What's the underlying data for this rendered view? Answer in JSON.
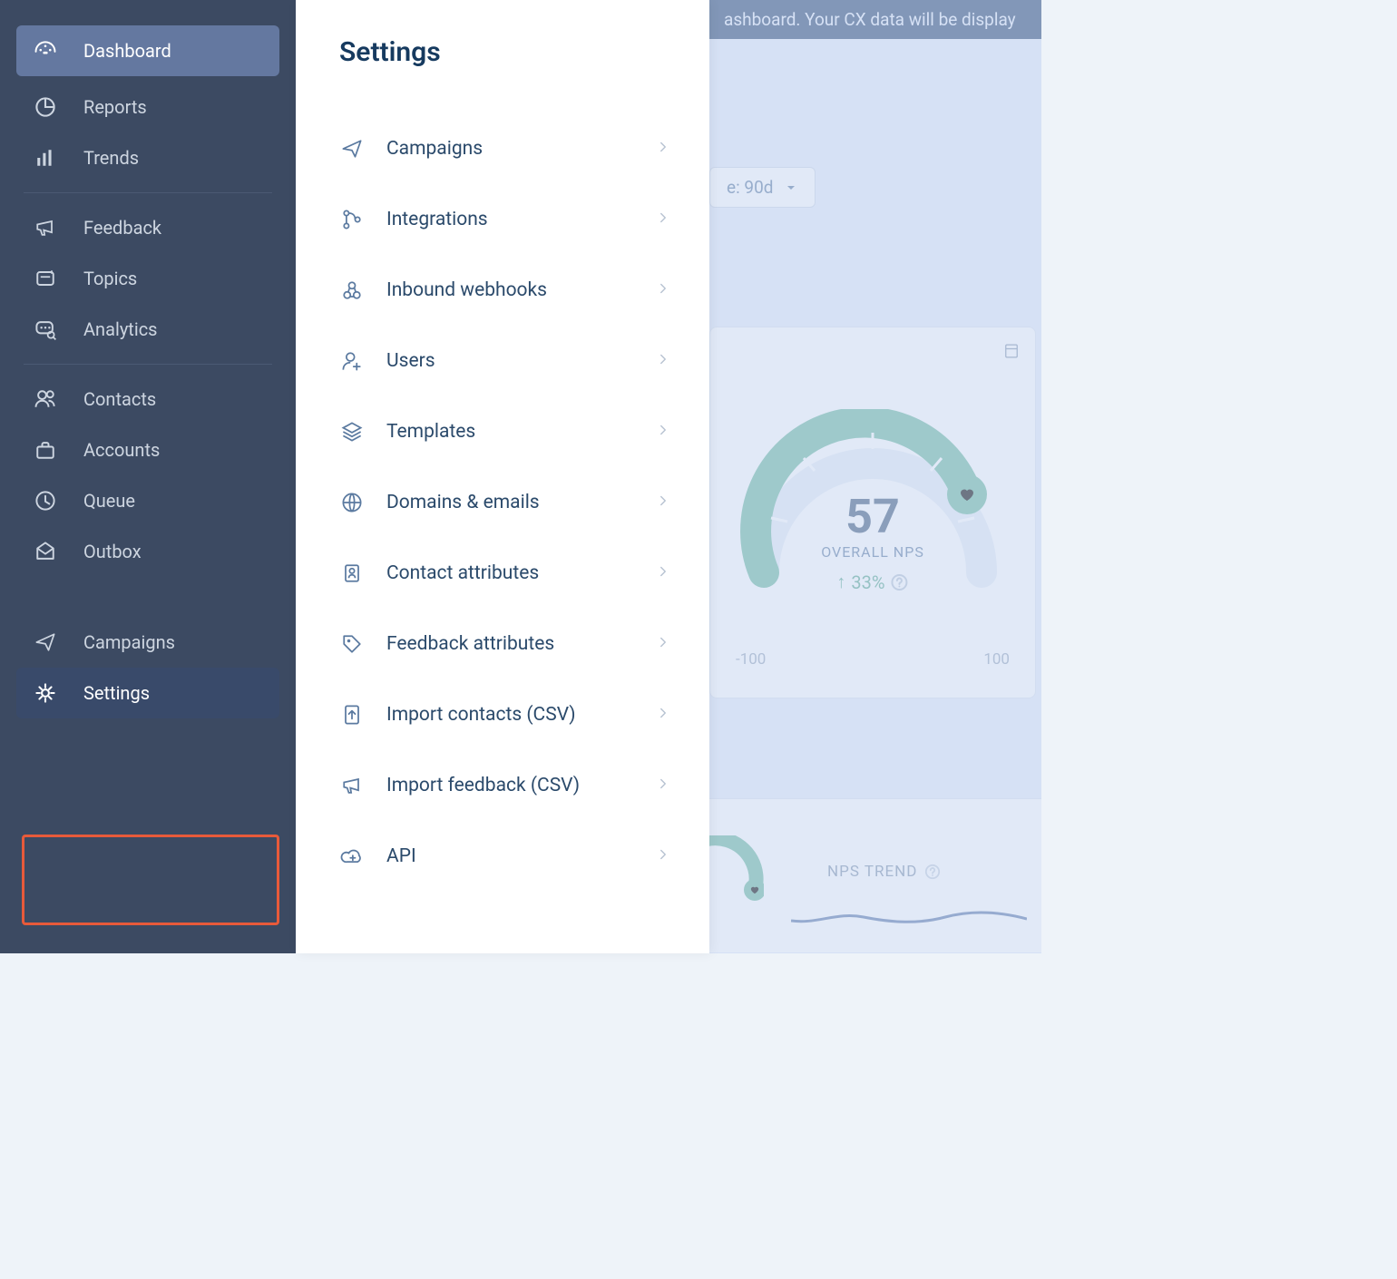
{
  "sidebar": {
    "items": [
      {
        "label": "Dashboard",
        "icon": "dashboard-icon",
        "active": true
      },
      {
        "label": "Reports",
        "icon": "pie-icon"
      },
      {
        "label": "Trends",
        "icon": "bars-icon"
      }
    ],
    "items2": [
      {
        "label": "Feedback",
        "icon": "megaphone-icon"
      },
      {
        "label": "Topics",
        "icon": "card-icon"
      },
      {
        "label": "Analytics",
        "icon": "chat-search-icon"
      }
    ],
    "items3": [
      {
        "label": "Contacts",
        "icon": "people-icon"
      },
      {
        "label": "Accounts",
        "icon": "briefcase-icon"
      },
      {
        "label": "Queue",
        "icon": "clock-icon"
      },
      {
        "label": "Outbox",
        "icon": "envelope-icon"
      }
    ],
    "items4": [
      {
        "label": "Campaigns",
        "icon": "send-icon"
      },
      {
        "label": "Settings",
        "icon": "gear-icon",
        "selected": true
      }
    ]
  },
  "settings": {
    "title": "Settings",
    "items": [
      {
        "label": "Campaigns",
        "icon": "send-icon"
      },
      {
        "label": "Integrations",
        "icon": "branch-icon"
      },
      {
        "label": "Inbound webhooks",
        "icon": "webhook-icon"
      },
      {
        "label": "Users",
        "icon": "user-add-icon"
      },
      {
        "label": "Templates",
        "icon": "layers-icon"
      },
      {
        "label": "Domains & emails",
        "icon": "globe-icon"
      },
      {
        "label": "Contact attributes",
        "icon": "id-card-icon"
      },
      {
        "label": "Feedback attributes",
        "icon": "tag-icon"
      },
      {
        "label": "Import contacts (CSV)",
        "icon": "file-up-icon"
      },
      {
        "label": "Import feedback (CSV)",
        "icon": "megaphone-icon"
      },
      {
        "label": "API",
        "icon": "cloud-plus-icon",
        "highlighted": true
      }
    ]
  },
  "dashboard": {
    "banner_text": "ashboard. Your CX data will be display",
    "range_label": "e: 90d",
    "nps": {
      "value": "57",
      "label": "OVERALL NPS",
      "delta": "33%",
      "min": "-100",
      "max": "100"
    },
    "trend_label": "NPS TREND"
  },
  "colors": {
    "accent_green": "#6ab89e",
    "highlight_red": "#e85a3a"
  },
  "chart_data": {
    "type": "gauge",
    "title": "OVERALL NPS",
    "min": -100,
    "max": 100,
    "value": 57,
    "delta_percent": 33
  }
}
